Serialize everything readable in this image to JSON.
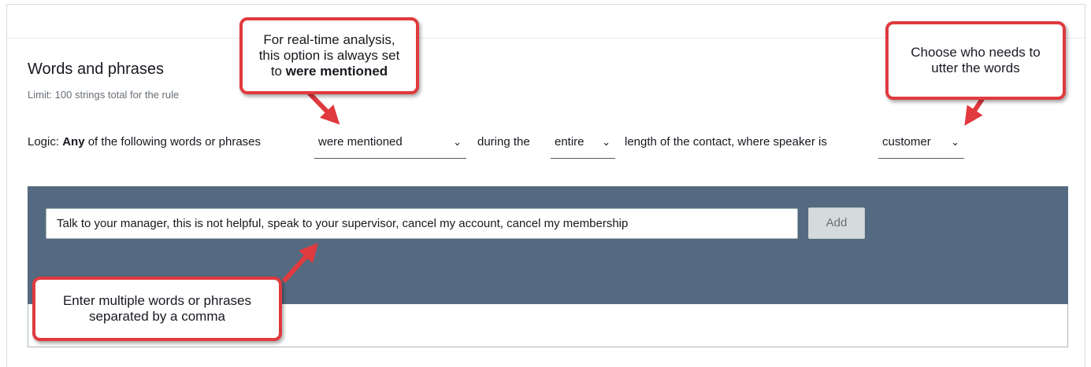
{
  "section": {
    "title": "Words and phrases",
    "limit_text": "Limit: 100 strings total for the rule"
  },
  "logic": {
    "prefix": "Logic:",
    "any": "Any",
    "text1": "of the following words or phrases",
    "mention_select": "were mentioned",
    "text2": "during the",
    "duration_select": "entire",
    "text3": "length of the contact, where speaker is",
    "speaker_select": "customer"
  },
  "phrases": {
    "input_value": "Talk to your manager, this is not helpful, speak to your supervisor, cancel my account, cancel my membership",
    "add_label": "Add"
  },
  "callouts": {
    "realtime_line1": "For real-time analysis,",
    "realtime_line2": "this option is always set",
    "realtime_line3_pre": "to",
    "realtime_line3_bold": "were mentioned",
    "speaker_line1": "Choose who needs to",
    "speaker_line2": "utter the words",
    "multi_line1": "Enter multiple words or phrases",
    "multi_line2": "separated by a comma"
  },
  "colors": {
    "callout_border": "#e03a3e",
    "panel_bg": "#546a80"
  }
}
